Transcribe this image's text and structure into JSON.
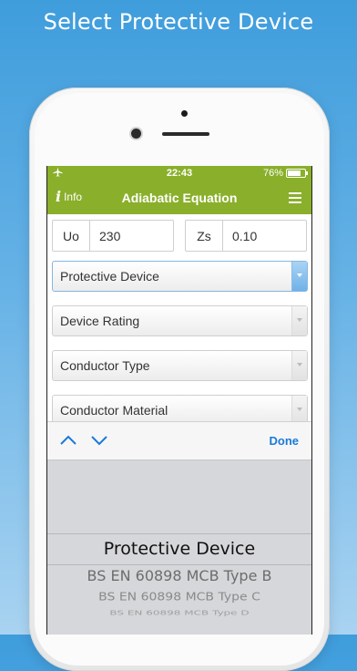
{
  "headline": "Select Protective Device",
  "status": {
    "time": "22:43",
    "battery_text": "76%",
    "battery_level": 0.76
  },
  "navbar": {
    "info_label": "Info",
    "title": "Adiabatic Equation"
  },
  "inputs": {
    "uo": {
      "label": "Uo",
      "value": "230"
    },
    "zs": {
      "label": "Zs",
      "value": "0.10"
    }
  },
  "selects": [
    {
      "label": "Protective Device",
      "active": true
    },
    {
      "label": "Device Rating",
      "active": false
    },
    {
      "label": "Conductor Type",
      "active": false
    },
    {
      "label": "Conductor Material",
      "active": false
    }
  ],
  "toolbar": {
    "done_label": "Done"
  },
  "picker": {
    "selected": "Protective Device",
    "options": [
      "BS EN 60898 MCB Type B",
      "BS EN 60898 MCB Type C",
      "BS EN 60898 MCB Type D"
    ]
  },
  "colors": {
    "brand_green": "#8aaf2b",
    "accent_blue": "#1a7ad8",
    "background_blue": "#3f9ddc"
  },
  "icons": {
    "airplane": "airplane-icon",
    "battery": "battery-icon",
    "menu": "hamburger-menu-icon",
    "prev": "chevron-up-icon",
    "next": "chevron-down-icon"
  }
}
